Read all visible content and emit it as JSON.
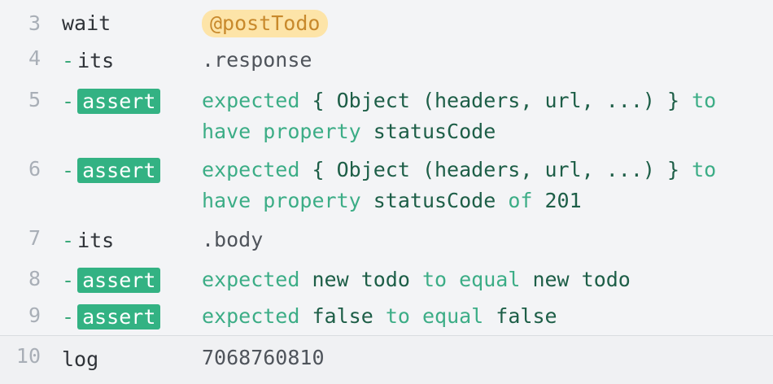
{
  "rows": [
    {
      "num": "3",
      "cmd": "wait",
      "alias": "@postTodo"
    },
    {
      "num": "4",
      "dash": "-",
      "cmd": "its",
      "msg": ".response"
    },
    {
      "num": "5",
      "dash": "-",
      "badge": "assert",
      "parts": [
        "expected",
        "{ Object (headers, url, ...) }",
        "to",
        "have property",
        "statusCode"
      ]
    },
    {
      "num": "6",
      "dash": "-",
      "badge": "assert",
      "parts": [
        "expected",
        "{ Object (headers, url, ...) }",
        "to",
        "have property",
        "statusCode",
        "of",
        "201"
      ]
    },
    {
      "num": "7",
      "dash": "-",
      "cmd": "its",
      "msg": ".body"
    },
    {
      "num": "8",
      "dash": "-",
      "badge": "assert",
      "parts": [
        "expected",
        "new todo",
        "to equal",
        "new todo"
      ]
    },
    {
      "num": "9",
      "dash": "-",
      "badge": "assert",
      "parts": [
        "expected",
        "false",
        "to equal",
        "false"
      ]
    },
    {
      "num": "10",
      "cmd": "log",
      "msg": "7068760810"
    }
  ],
  "colors": {
    "assert_badge": "#33b283",
    "alias_badge_bg": "#fde4a8",
    "alias_badge_text": "#c8892c",
    "keyword": "#3cad86",
    "value": "#1d5e47"
  }
}
